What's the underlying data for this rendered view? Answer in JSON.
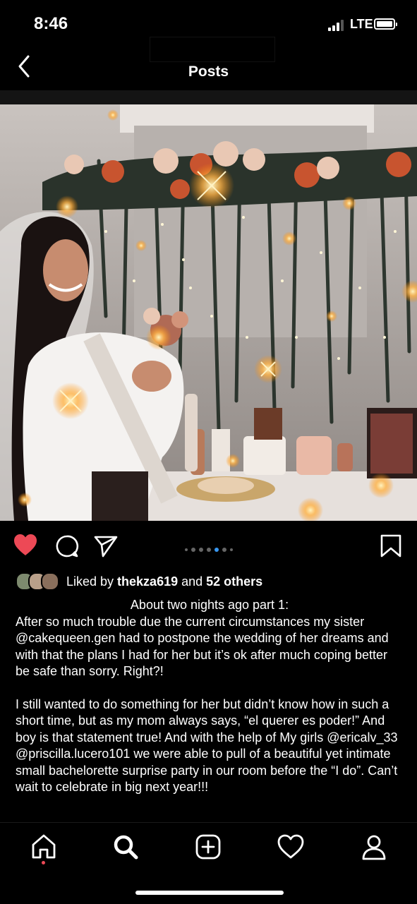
{
  "status_bar": {
    "time": "8:46",
    "network": "LTE"
  },
  "nav": {
    "title": "Posts",
    "back_icon": "chevron-left-icon"
  },
  "post": {
    "liked": true,
    "carousel": {
      "total": 7,
      "active": 5
    },
    "likes": {
      "prefix": "Liked by ",
      "user": "thekza619",
      "middle": " and ",
      "others": "52 others"
    },
    "caption": {
      "header": "About two nights ago part 1:",
      "para1": "After so much trouble due the current circumstances my sister @cakequeen.gen had to postpone the wedding of her dreams and with that the plans I had for her but it’s ok after much coping better be safe than sorry. Right?!",
      "para2": "I still wanted to do something for her but didn’t know how in such a short time, but as my mom always says, “el querer es poder!” And boy is that statement true! And with the help of My girls @ericalv_33 @priscilla.lucero101 we were able to pull of a beautiful yet intimate small bachelorette surprise party in our room before the “I do”. Can’t wait to celebrate in big next year!!!"
    }
  },
  "tab_bar": {
    "items": [
      "home-icon",
      "search-icon",
      "new-post-icon",
      "activity-heart-icon",
      "profile-icon"
    ],
    "has_notification": true
  },
  "colors": {
    "like_red": "#ed4956",
    "carousel_active": "#3897f0",
    "background": "#000000"
  }
}
